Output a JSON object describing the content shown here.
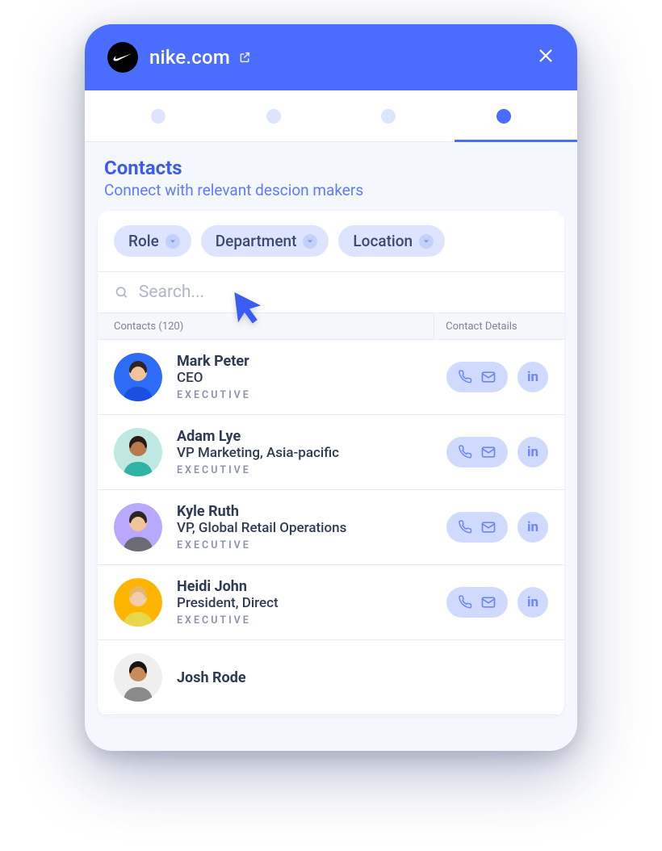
{
  "header": {
    "domain": "nike.com"
  },
  "section": {
    "title": "Contacts",
    "subtitle": "Connect with relevant descion makers"
  },
  "filters": [
    {
      "label": "Role"
    },
    {
      "label": "Department"
    },
    {
      "label": "Location"
    }
  ],
  "search": {
    "placeholder": "Search..."
  },
  "columns": {
    "contacts": "Contacts (120)",
    "details": "Contact Details"
  },
  "linkedin_label": "in",
  "contacts": [
    {
      "name": "Mark Peter",
      "role": "CEO",
      "badge": "EXECUTIVE",
      "avatar_bg": "#2D6CF6",
      "shirt": "#1A4FE0",
      "skin": "#F0C39B",
      "hair": "#2E251E"
    },
    {
      "name": "Adam Lye",
      "role": "VP Marketing, Asia-pacific",
      "badge": "EXECUTIVE",
      "avatar_bg": "#BFE8E2",
      "shirt": "#2FB3A4",
      "skin": "#B8794F",
      "hair": "#2A1B12"
    },
    {
      "name": "Kyle Ruth",
      "role": "VP, Global Retail Operations",
      "badge": "EXECUTIVE",
      "avatar_bg": "#B8A8FF",
      "shirt": "#6B6B73",
      "skin": "#F0C39B",
      "hair": "#2E251E"
    },
    {
      "name": "Heidi John",
      "role": "President, Direct",
      "badge": "EXECUTIVE",
      "avatar_bg": "#FFB400",
      "shirt": "#E8D74A",
      "skin": "#F3CDA9",
      "hair": "#E7B768"
    },
    {
      "name": "Josh Rode",
      "role": "",
      "badge": "",
      "avatar_bg": "#EFEFEF",
      "shirt": "#8A8A8A",
      "skin": "#C98B5C",
      "hair": "#1C1410"
    }
  ]
}
